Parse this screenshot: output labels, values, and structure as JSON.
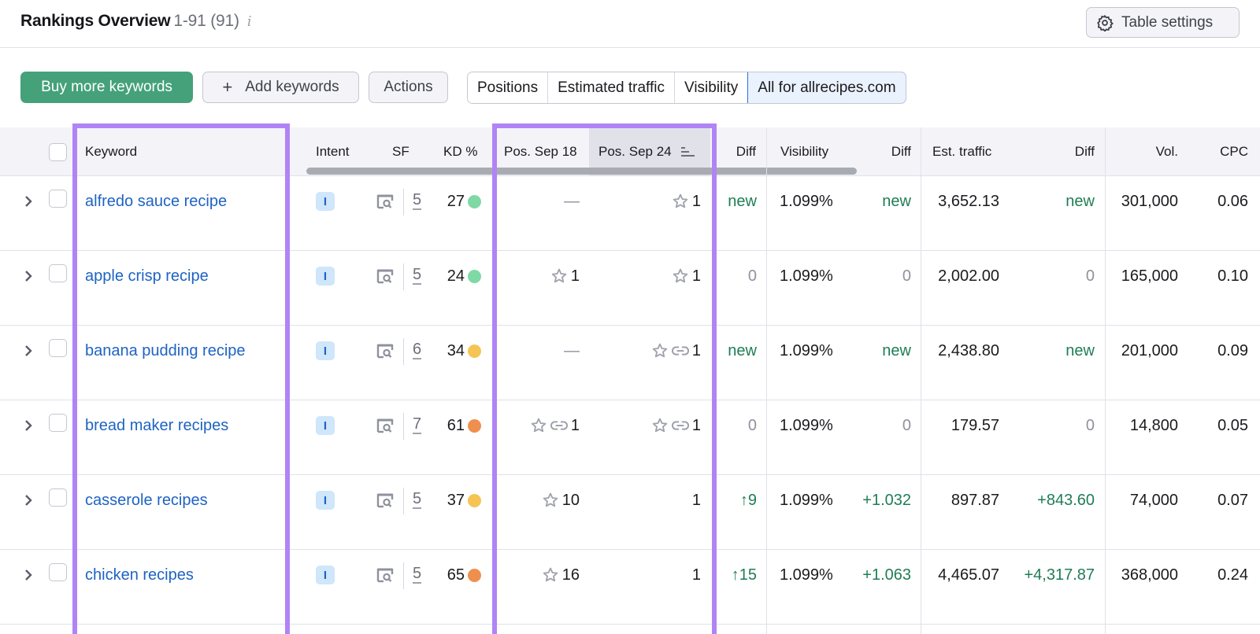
{
  "header": {
    "title": "Rankings Overview",
    "range": "1-91 (91)",
    "info_icon": "i",
    "table_settings_label": "Table settings"
  },
  "toolbar": {
    "buy_label": "Buy more keywords",
    "add_icon": "+",
    "add_label": "Add keywords",
    "actions_label": "Actions",
    "segments": [
      {
        "label": "Positions",
        "active": false
      },
      {
        "label": "Estimated traffic",
        "active": false
      },
      {
        "label": "Visibility",
        "active": false
      },
      {
        "label": "All for allrecipes.com",
        "active": true
      }
    ]
  },
  "table": {
    "columns": {
      "keyword": "Keyword",
      "intent": "Intent",
      "sf": "SF",
      "kd": "KD %",
      "pos1": "Pos. Sep 18",
      "pos2": "Pos. Sep 24",
      "diff": "Diff",
      "visibility": "Visibility",
      "vis_diff": "Diff",
      "traffic": "Est. traffic",
      "traffic_diff": "Diff",
      "vol": "Vol.",
      "cpc": "CPC"
    },
    "sorted_column": "Pos. Sep 24",
    "rows": [
      {
        "keyword": "alfredo sauce recipe",
        "intent": "I",
        "sf": "5",
        "kd": "27",
        "kd_color": "#7fd9a4",
        "pos1": "—",
        "pos1_star": false,
        "pos1_link": false,
        "pos2": "1",
        "pos2_star": true,
        "pos2_link": false,
        "diff": "new",
        "diff_class": "green",
        "visibility": "1.099%",
        "vis_diff": "new",
        "vis_diff_class": "green",
        "traffic": "3,652.13",
        "traffic_diff": "new",
        "traffic_diff_class": "green",
        "vol": "301,000",
        "cpc": "0.06"
      },
      {
        "keyword": "apple crisp recipe",
        "intent": "I",
        "sf": "5",
        "kd": "24",
        "kd_color": "#7fd9a4",
        "pos1": "1",
        "pos1_star": true,
        "pos1_link": false,
        "pos2": "1",
        "pos2_star": true,
        "pos2_link": false,
        "diff": "0",
        "diff_class": "muted",
        "visibility": "1.099%",
        "vis_diff": "0",
        "vis_diff_class": "muted",
        "traffic": "2,002.00",
        "traffic_diff": "0",
        "traffic_diff_class": "muted",
        "vol": "165,000",
        "cpc": "0.10"
      },
      {
        "keyword": "banana pudding recipe",
        "intent": "I",
        "sf": "6",
        "kd": "34",
        "kd_color": "#f5c453",
        "pos1": "—",
        "pos1_star": false,
        "pos1_link": false,
        "pos2": "1",
        "pos2_star": true,
        "pos2_link": true,
        "diff": "new",
        "diff_class": "green",
        "visibility": "1.099%",
        "vis_diff": "new",
        "vis_diff_class": "green",
        "traffic": "2,438.80",
        "traffic_diff": "new",
        "traffic_diff_class": "green",
        "vol": "201,000",
        "cpc": "0.09"
      },
      {
        "keyword": "bread maker recipes",
        "intent": "I",
        "sf": "7",
        "kd": "61",
        "kd_color": "#ef8f4f",
        "pos1": "1",
        "pos1_star": true,
        "pos1_link": true,
        "pos2": "1",
        "pos2_star": true,
        "pos2_link": true,
        "diff": "0",
        "diff_class": "muted",
        "visibility": "1.099%",
        "vis_diff": "0",
        "vis_diff_class": "muted",
        "traffic": "179.57",
        "traffic_diff": "0",
        "traffic_diff_class": "muted",
        "vol": "14,800",
        "cpc": "0.05"
      },
      {
        "keyword": "casserole recipes",
        "intent": "I",
        "sf": "5",
        "kd": "37",
        "kd_color": "#f5c453",
        "pos1": "10",
        "pos1_star": true,
        "pos1_link": false,
        "pos2": "1",
        "pos2_star": false,
        "pos2_link": false,
        "diff": "↑9",
        "diff_class": "green",
        "visibility": "1.099%",
        "vis_diff": "+1.032",
        "vis_diff_class": "green",
        "traffic": "897.87",
        "traffic_diff": "+843.60",
        "traffic_diff_class": "green",
        "vol": "74,000",
        "cpc": "0.07"
      },
      {
        "keyword": "chicken recipes",
        "intent": "I",
        "sf": "5",
        "kd": "65",
        "kd_color": "#ef8f4f",
        "pos1": "16",
        "pos1_star": true,
        "pos1_link": false,
        "pos2": "1",
        "pos2_star": false,
        "pos2_link": false,
        "diff": "↑15",
        "diff_class": "green",
        "visibility": "1.099%",
        "vis_diff": "+1.063",
        "vis_diff_class": "green",
        "traffic": "4,465.07",
        "traffic_diff": "+4,317.87",
        "traffic_diff_class": "green",
        "vol": "368,000",
        "cpc": "0.24"
      }
    ]
  },
  "icons": {
    "star": "☆",
    "link": "⊖",
    "chevron": "›",
    "sort": "sort-desc-icon"
  },
  "colors": {
    "brand_green": "#45a17a",
    "link_blue": "#1e63c4",
    "positive_green": "#1f7d55",
    "highlight_purple": "#b084f5"
  }
}
